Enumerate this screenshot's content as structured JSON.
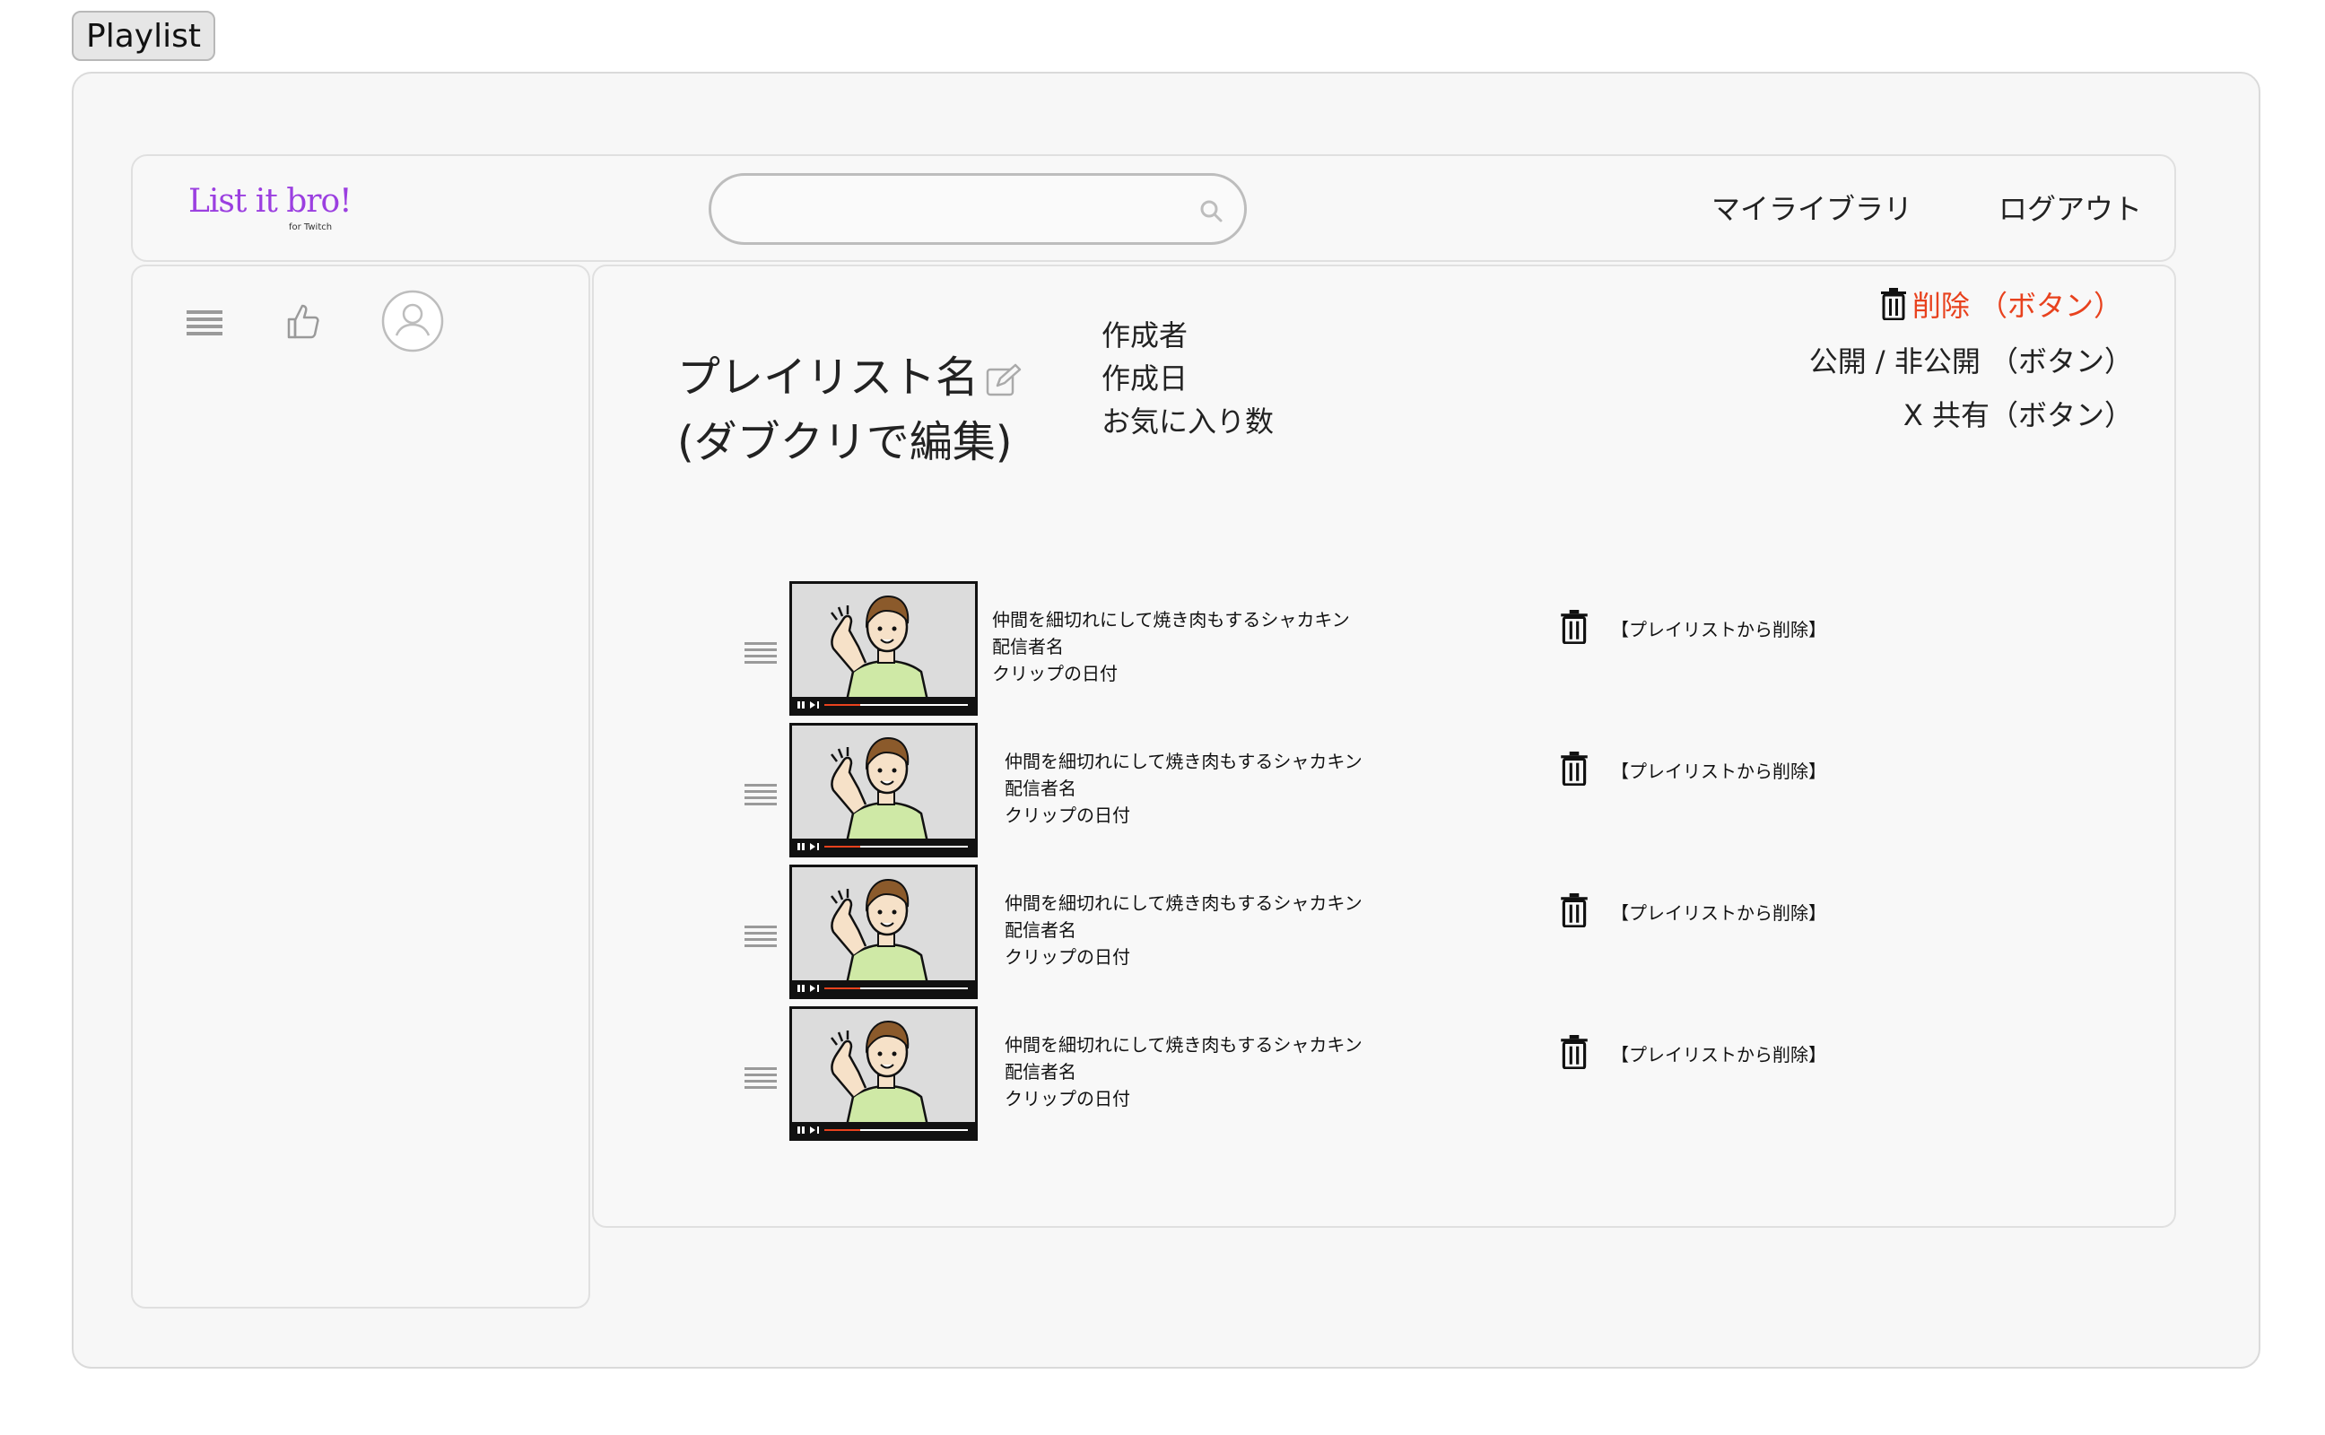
{
  "frame_tab": "Playlist",
  "header": {
    "logo": "List it bro!",
    "logo_sub": "for Twitch",
    "search": {
      "placeholder": "",
      "value": ""
    },
    "nav": [
      "マイライブラリ",
      "ログアウト"
    ]
  },
  "sidebar": {
    "icons": [
      "list-icon",
      "thumbs-up-icon",
      "user-icon"
    ]
  },
  "playlist": {
    "title_line1": "プレイリスト名",
    "title_line2": "(ダブクリで編集)",
    "meta": [
      "作成者",
      "作成日",
      "お気に入り数"
    ],
    "actions": {
      "delete": "削除 （ボタン）",
      "visibility": "公開 / 非公開 （ボタン）",
      "share": "X 共有（ボタン）"
    },
    "delete_color": "#e8421e"
  },
  "clips": [
    {
      "title": "仲間を細切れにして焼き肉もするシャカキン",
      "streamer": "配信者名",
      "date": "クリップの日付",
      "remove_label": "【プレイリストから削除】"
    },
    {
      "title": "仲間を細切れにして焼き肉もするシャカキン",
      "streamer": "配信者名",
      "date": "クリップの日付",
      "remove_label": "【プレイリストから削除】"
    },
    {
      "title": "仲間を細切れにして焼き肉もするシャカキン",
      "streamer": "配信者名",
      "date": "クリップの日付",
      "remove_label": "【プレイリストから削除】"
    },
    {
      "title": "仲間を細切れにして焼き肉もするシャカキン",
      "streamer": "配信者名",
      "date": "クリップの日付",
      "remove_label": "【プレイリストから削除】"
    }
  ]
}
